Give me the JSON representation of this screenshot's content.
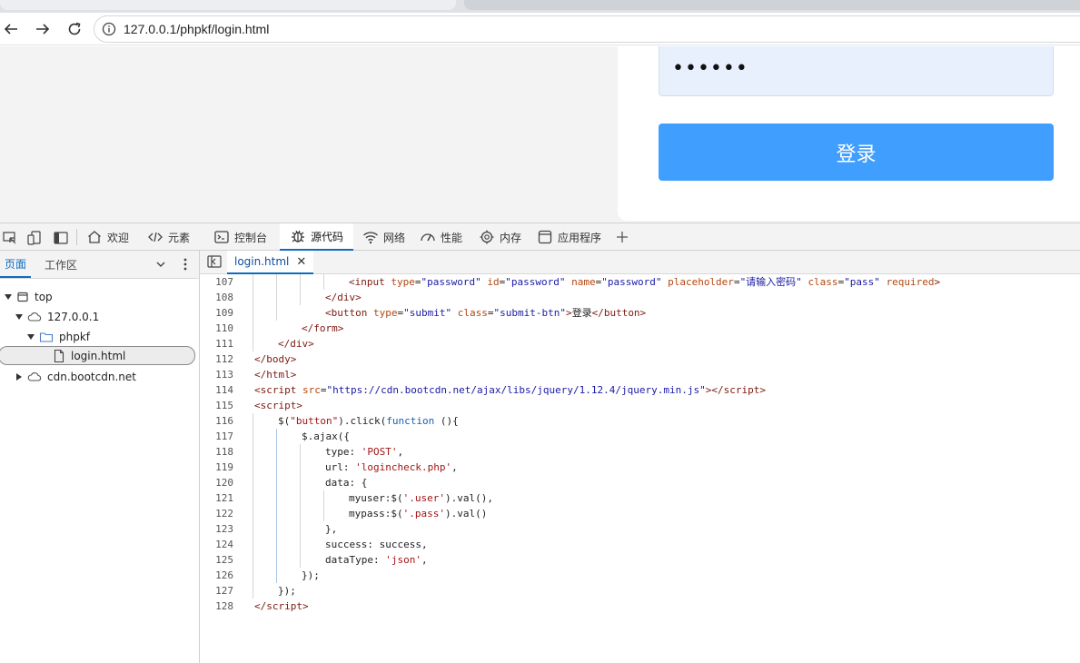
{
  "browser": {
    "url": "127.0.0.1/phpkf/login.html"
  },
  "page": {
    "password_dots": "••••••",
    "submit_label": "登录"
  },
  "devtools": {
    "tabs": [
      {
        "label": "欢迎",
        "icon": "home-icon"
      },
      {
        "label": "元素",
        "icon": "code-icon"
      },
      {
        "label": "控制台",
        "icon": "console-icon"
      },
      {
        "label": "源代码",
        "icon": "bug-icon"
      },
      {
        "label": "网络",
        "icon": "wifi-icon"
      },
      {
        "label": "性能",
        "icon": "gauge-icon"
      },
      {
        "label": "内存",
        "icon": "chip-icon"
      },
      {
        "label": "应用程序",
        "icon": "app-icon"
      }
    ],
    "active_tab": "源代码",
    "nav_tabs": [
      "页面",
      "工作区"
    ],
    "tree": [
      {
        "label": "top",
        "icon": "frame-icon",
        "expanded": true
      },
      {
        "label": "127.0.0.1",
        "icon": "cloud-icon",
        "expanded": true
      },
      {
        "label": "phpkf",
        "icon": "folder-icon",
        "expanded": true
      },
      {
        "label": "login.html",
        "icon": "file-icon",
        "selected": true
      },
      {
        "label": "cdn.bootcdn.net",
        "icon": "cloud-icon",
        "expanded": false
      }
    ],
    "editor_tab": "login.html",
    "code_lines": [
      {
        "n": "107",
        "indent": 4,
        "html": "<span class=\"t\">&lt;input</span> <span class=\"a\">type</span>=<span class=\"v\">\"password\"</span> <span class=\"a\">id</span>=<span class=\"v\">\"password\"</span> <span class=\"a\">name</span>=<span class=\"v\">\"password\"</span> <span class=\"a\">placeholder</span>=<span class=\"v\">\"请输入密码\"</span> <span class=\"a\">class</span>=<span class=\"v\">\"pass\"</span> <span class=\"a\">required</span><span class=\"t\">&gt;</span>"
      },
      {
        "n": "108",
        "indent": 3,
        "html": "<span class=\"t\">&lt;/div&gt;</span>"
      },
      {
        "n": "109",
        "indent": 3,
        "html": "<span class=\"t\">&lt;button</span> <span class=\"a\">type</span>=<span class=\"v\">\"submit\"</span> <span class=\"a\">class</span>=<span class=\"v\">\"submit-btn\"</span><span class=\"t\">&gt;</span>登录<span class=\"t\">&lt;/button&gt;</span>"
      },
      {
        "n": "110",
        "indent": 2,
        "html": "<span class=\"t\">&lt;/form&gt;</span>"
      },
      {
        "n": "111",
        "indent": 1,
        "html": "<span class=\"t\">&lt;/div&gt;</span>"
      },
      {
        "n": "112",
        "indent": 0,
        "html": "<span class=\"t\">&lt;/body&gt;</span>"
      },
      {
        "n": "113",
        "indent": 0,
        "html": "<span class=\"t\">&lt;/html&gt;</span>"
      },
      {
        "n": "114",
        "indent": 0,
        "html": "<span class=\"t\">&lt;script</span> <span class=\"a\">src</span>=<span class=\"v\">\"https://cdn.bootcdn.net/ajax/libs/jquery/1.12.4/jquery.min.js\"</span><span class=\"t\">&gt;&lt;/script&gt;</span>"
      },
      {
        "n": "115",
        "indent": 0,
        "html": "<span class=\"t\">&lt;script&gt;</span>"
      },
      {
        "n": "116",
        "indent": 1,
        "html": "$(<span class=\"s\">\"button\"</span>).click(<span class=\"k\">function</span> (){"
      },
      {
        "n": "117",
        "indent": 2,
        "html": "$.ajax({"
      },
      {
        "n": "118",
        "indent": 3,
        "html": "type: <span class=\"s\">'POST'</span>,"
      },
      {
        "n": "119",
        "indent": 3,
        "html": "url: <span class=\"s\">'logincheck.php'</span>,"
      },
      {
        "n": "120",
        "indent": 3,
        "html": "data: {"
      },
      {
        "n": "121",
        "indent": 4,
        "html": "myuser:$(<span class=\"s\">'.user'</span>).val(),"
      },
      {
        "n": "122",
        "indent": 4,
        "html": "mypass:$(<span class=\"s\">'.pass'</span>).val()"
      },
      {
        "n": "123",
        "indent": 3,
        "html": "},"
      },
      {
        "n": "124",
        "indent": 3,
        "html": "success: success,"
      },
      {
        "n": "125",
        "indent": 3,
        "html": "dataType: <span class=\"s\">'json'</span>,"
      },
      {
        "n": "126",
        "indent": 2,
        "html": "});"
      },
      {
        "n": "127",
        "indent": 1,
        "html": "});"
      },
      {
        "n": "128",
        "indent": 0,
        "html": "<span class=\"t\">&lt;/script&gt;</span>"
      }
    ]
  },
  "colors": {
    "submit_button": "#409eff",
    "password_fill": "#e8f0fe",
    "devtools_accent": "#0f6cbd"
  }
}
